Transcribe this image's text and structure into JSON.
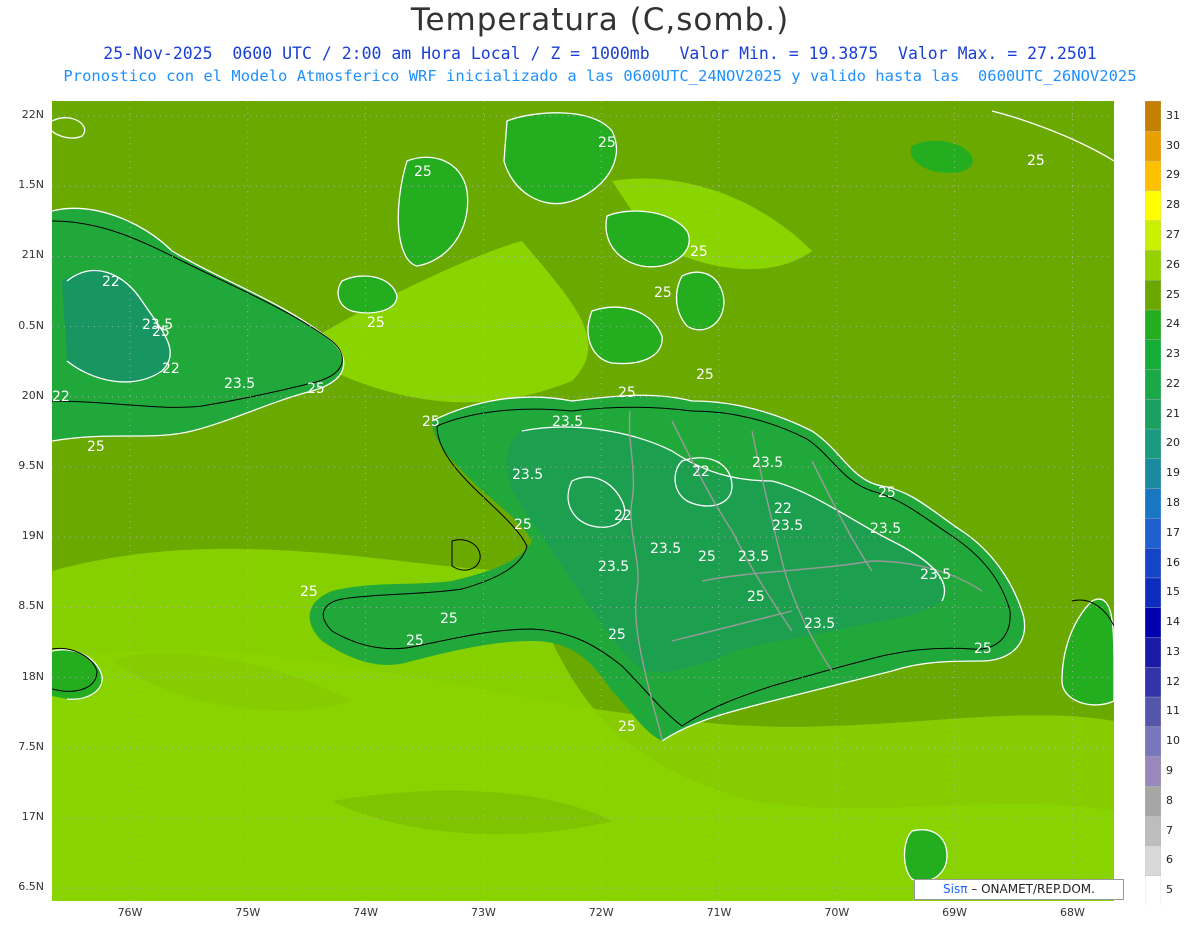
{
  "title": "Temperatura (C,somb.)",
  "subtitle_line1": "25-Nov-2025  0600 UTC / 2:00 am Hora Local / Z = 1000mb   Valor Min. = 19.3875  Valor Max. = 27.2501",
  "subtitle_line2": "Pronostico con el Modelo Atmosferico WRF inicializado a las 0600UTC_24NOV2025 y valido hasta las  0600UTC_26NOV2025",
  "credit": {
    "brand": "Sisπ",
    "text": " – ONAMET/REP.DOM."
  },
  "lat_labels": [
    "22N",
    "1.5N",
    "21N",
    "0.5N",
    "20N",
    "9.5N",
    "19N",
    "8.5N",
    "18N",
    "7.5N",
    "17N",
    "6.5N"
  ],
  "lon_labels": [
    "76W",
    "75W",
    "74W",
    "73W",
    "72W",
    "71W",
    "70W",
    "69W",
    "68W"
  ],
  "colorbar": {
    "levels": [
      "5",
      "6",
      "7",
      "8",
      "9",
      "10",
      "11",
      "12",
      "13",
      "14",
      "15",
      "16",
      "17",
      "18",
      "19",
      "20",
      "21",
      "22",
      "23",
      "24",
      "25",
      "26",
      "27",
      "28",
      "29",
      "30",
      "31"
    ],
    "colors": [
      "#ffffff",
      "#d9d9d9",
      "#bdbdbd",
      "#a6a6a6",
      "#9988bb",
      "#7777bb",
      "#5555aa",
      "#3333aa",
      "#1a1aa6",
      "#0000b0",
      "#0c2cbf",
      "#1445c8",
      "#1f5fd0",
      "#1976c0",
      "#1a8aa0",
      "#1a9a80",
      "#1aa060",
      "#1aa848",
      "#14ad38",
      "#25ad20",
      "#6aa800",
      "#95d000",
      "#c8f000",
      "#ffff00",
      "#ffc000",
      "#e8a000",
      "#c48000"
    ]
  },
  "contour_labels": [
    "25",
    "23.5",
    "22"
  ],
  "colors": {
    "sea_base": "#8ad200",
    "sea_dark": "#6aaa00",
    "land_green": "#20a83a",
    "land_dark": "#17936a",
    "contour": "#ffffff",
    "coast": "#000000",
    "border": "#999999"
  }
}
